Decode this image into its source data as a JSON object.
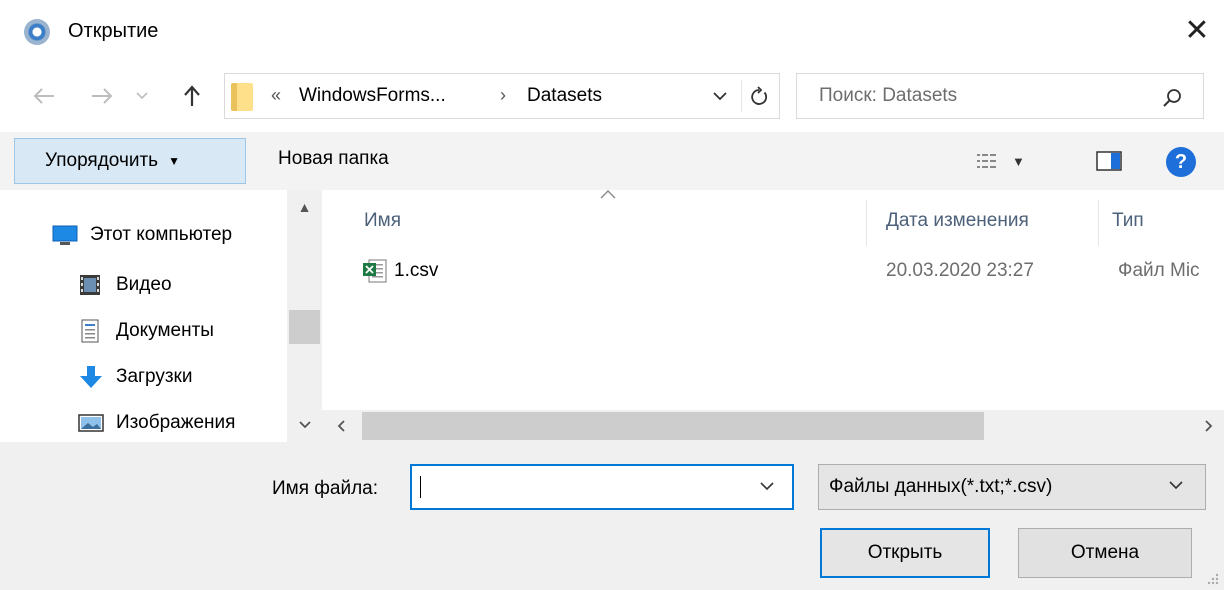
{
  "window": {
    "title": "Открытие",
    "close_glyph": "✕"
  },
  "address": {
    "overflow_glyph": "«",
    "crumbs": [
      "WindowsForms...",
      "Datasets"
    ],
    "separator_glyph": "›"
  },
  "search": {
    "placeholder": "Поиск: Datasets"
  },
  "toolbar": {
    "organize_label": "Упорядочить",
    "new_folder_label": "Новая папка",
    "help_glyph": "?"
  },
  "navpane": {
    "items": [
      {
        "label": "Этот компьютер",
        "icon": "computer-icon"
      },
      {
        "label": "Видео",
        "icon": "video-icon"
      },
      {
        "label": "Документы",
        "icon": "documents-icon"
      },
      {
        "label": "Загрузки",
        "icon": "downloads-icon"
      },
      {
        "label": "Изображения",
        "icon": "pictures-icon"
      }
    ]
  },
  "filelist": {
    "columns": [
      "Имя",
      "Дата изменения",
      "Тип"
    ],
    "rows": [
      {
        "name": "1.csv",
        "date": "20.03.2020 23:27",
        "type": "Файл Mic",
        "icon": "excel-csv-icon"
      }
    ]
  },
  "bottom": {
    "filename_label": "Имя файла:",
    "filename_value": "",
    "filetype_selected": "Файлы данных(*.txt;*.csv)",
    "open_label": "Открыть",
    "cancel_label": "Отмена"
  },
  "colors": {
    "accent": "#0078d7",
    "organize_bg": "#d8e8f5",
    "help_blue": "#1e6fd9"
  }
}
